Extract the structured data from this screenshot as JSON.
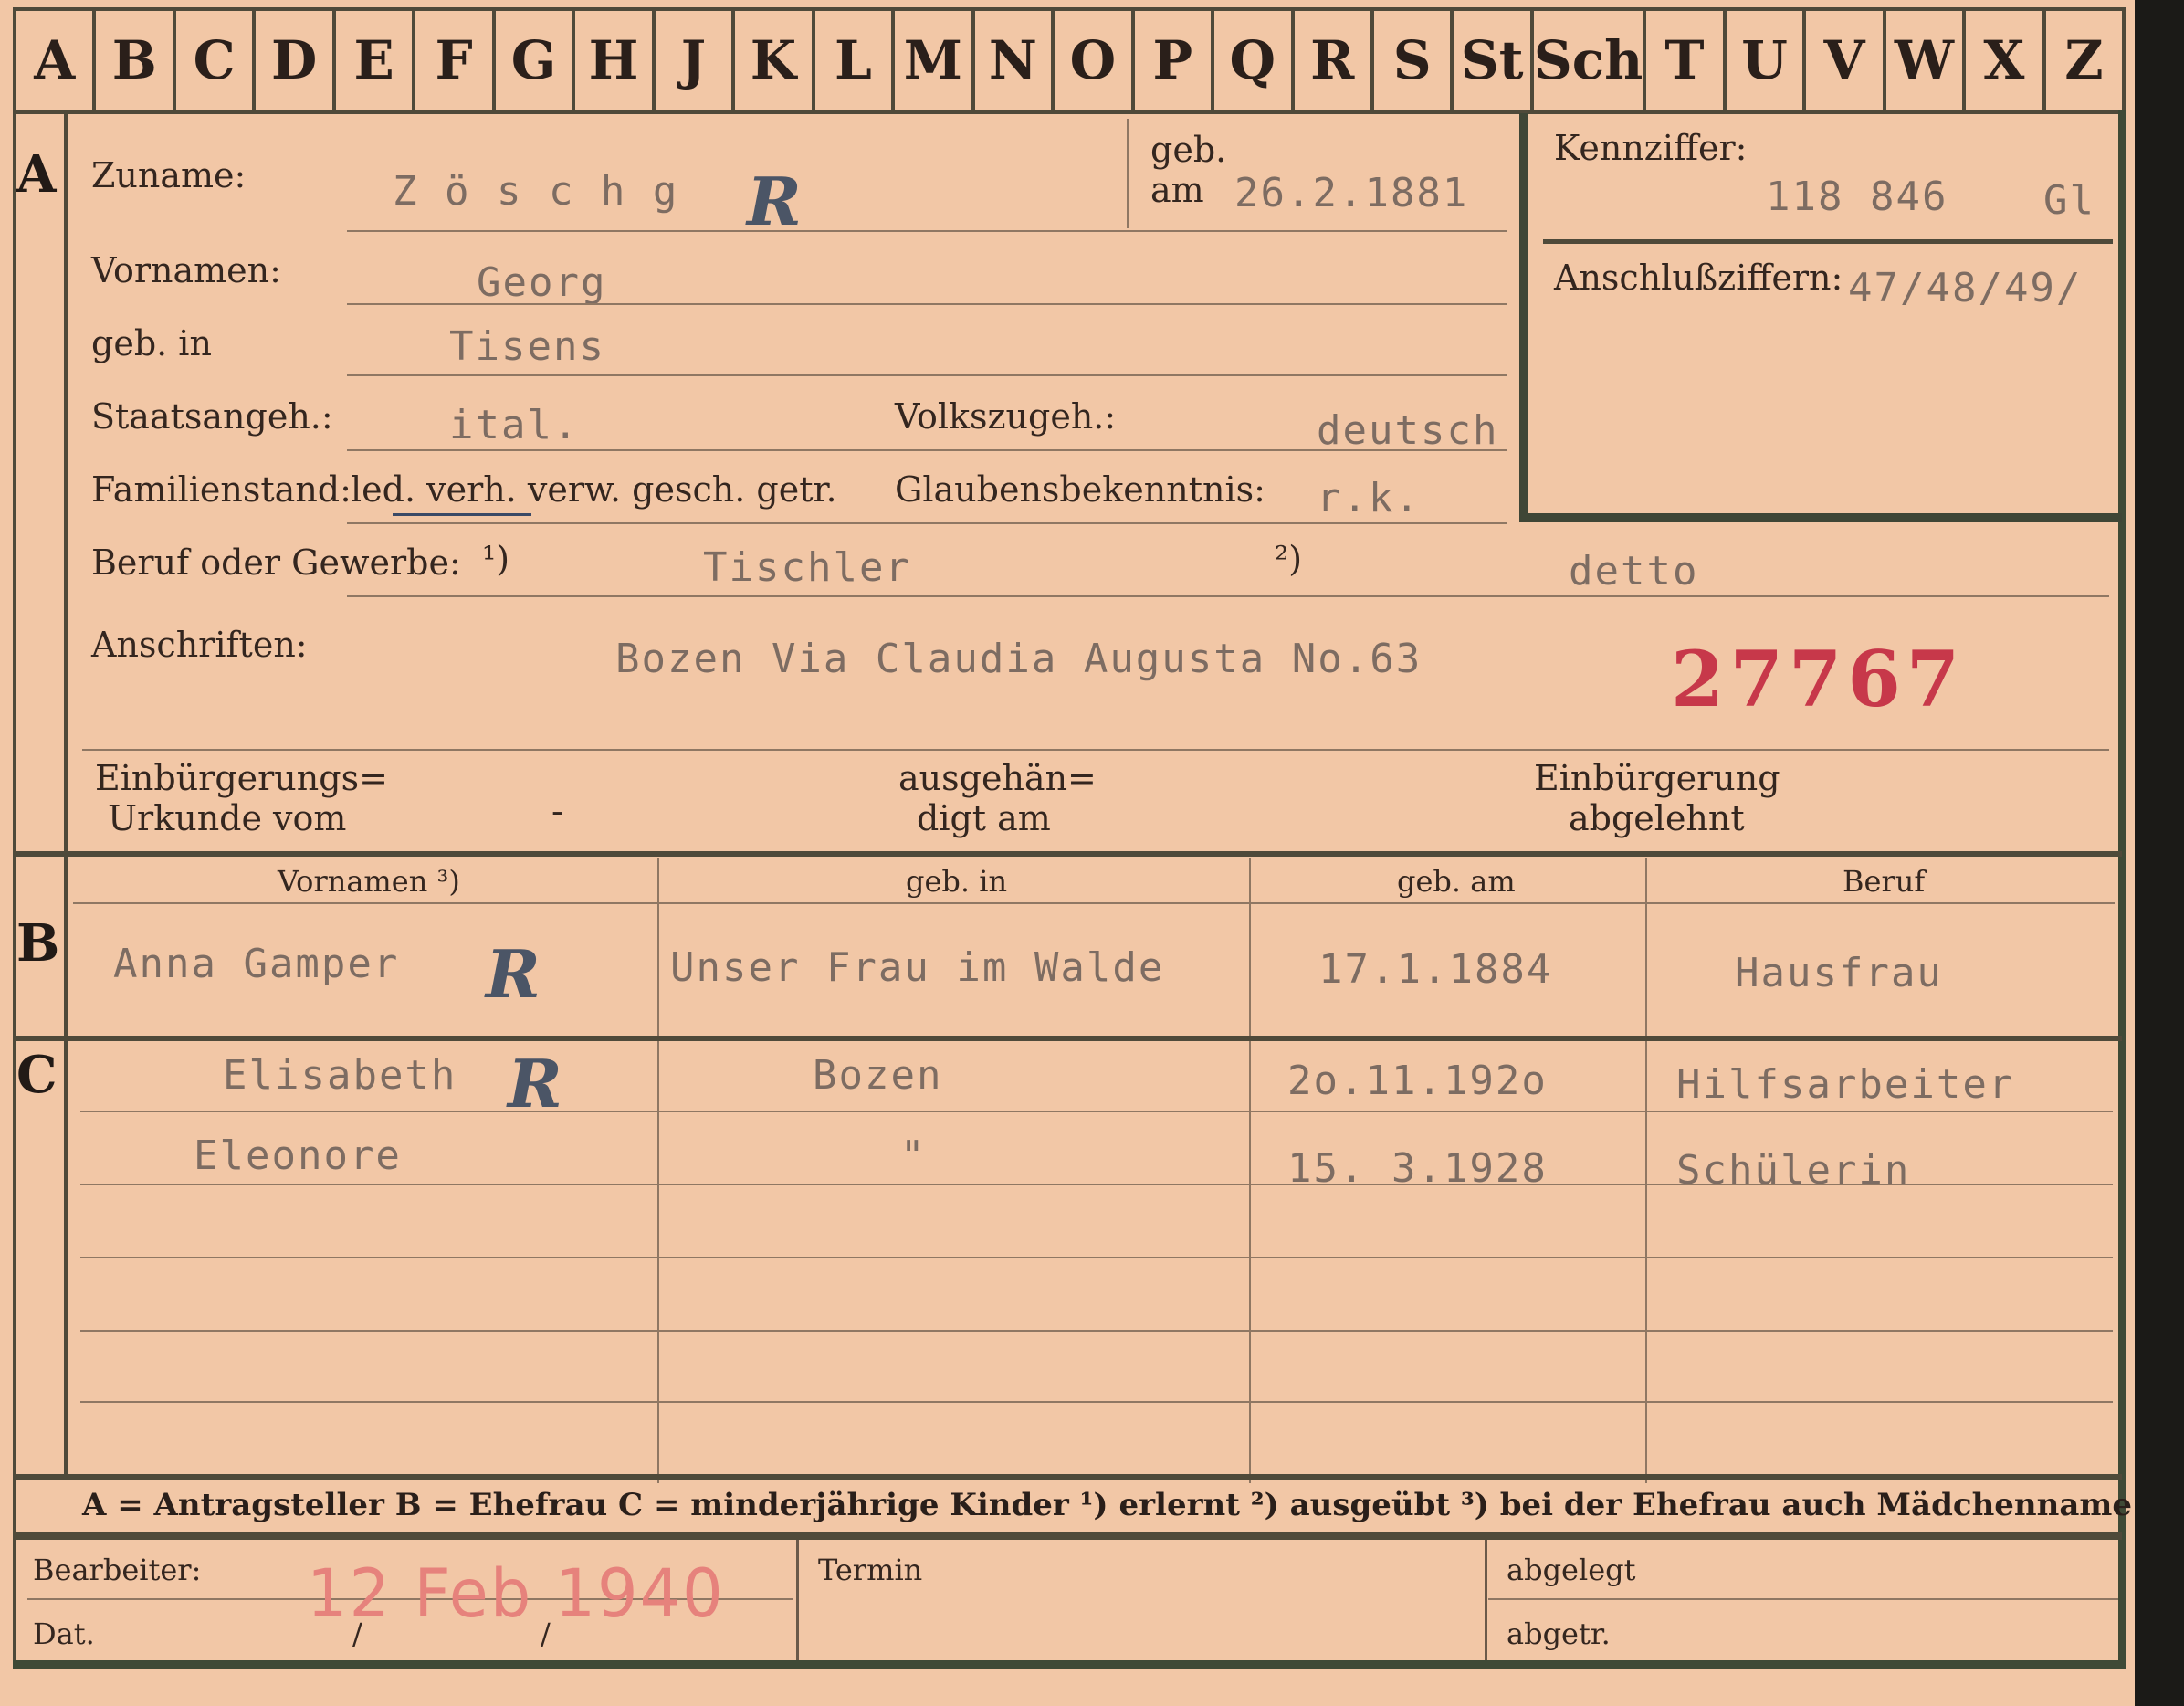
{
  "tabs": [
    "A",
    "B",
    "C",
    "D",
    "E",
    "F",
    "G",
    "H",
    "J",
    "K",
    "L",
    "M",
    "N",
    "O",
    "P",
    "Q",
    "R",
    "S",
    "St",
    "Sch",
    "T",
    "U",
    "V",
    "W",
    "X",
    "Z"
  ],
  "section_a": {
    "marker": "A",
    "surname_label": "Zuname:",
    "surname": "Z ö s c h g",
    "born_label_1": "geb.",
    "born_label_2": "am",
    "born_date": "26.2.1881",
    "first_names_label": "Vornamen:",
    "first_names": "Georg",
    "birthplace_label": "geb. in",
    "birthplace": "Tisens",
    "citizenship_label": "Staatsangeh.:",
    "citizenship": "ital.",
    "ethnicity_label": "Volkszugeh.:",
    "ethnicity": "deutsch",
    "marital_label": "Familienstand:",
    "marital_options": "led. verh. verw. gesch. getr.",
    "religion_label": "Glaubensbekenntnis:",
    "religion": "r.k.",
    "occupation_label": "Beruf oder Gewerbe:",
    "occupation_note_1": "¹)",
    "occupation_1": "Tischler",
    "occupation_note_2": "²)",
    "occupation_2": "detto",
    "address_label": "Anschriften:",
    "address": "Bozen Via Claudia Augusta No.63",
    "red_number": "27767",
    "naturalization_label_1": "Einbürgerungs=",
    "naturalization_label_2": "Urkunde vom",
    "naturalization_dash": "-",
    "handed_label_1": "ausgehän=",
    "handed_label_2": "digt am",
    "rejected_label_1": "Einbürgerung",
    "rejected_label_2": "abgelehnt",
    "code_label": "Kennziffer:",
    "code_value": "118 846",
    "code_suffix": "Gl",
    "connection_label": "Anschlußziffern:",
    "connection_value": "47/48/49/"
  },
  "section_b": {
    "marker": "B",
    "headers": [
      "Vornamen ³)",
      "geb. in",
      "geb. am",
      "Beruf"
    ],
    "row": [
      "Anna Gamper",
      "Unser Frau im Walde",
      "17.1.1884",
      "Hausfrau"
    ]
  },
  "section_c": {
    "marker": "C",
    "rows": [
      [
        "Elisabeth",
        "Bozen",
        "2o.11.192o",
        "Hilfsarbeiter"
      ],
      [
        "Eleonore",
        "\"",
        "15. 3.1928",
        "Schülerin"
      ]
    ]
  },
  "stamp_letter": "R",
  "legend": "A = Antragsteller   B = Ehefrau   C = minderjährige Kinder   ¹) erlernt   ²) ausgeübt   ³) bei der Ehefrau auch Mädchenname",
  "footer": {
    "editor_label": "Bearbeiter:",
    "date_label": "Dat.",
    "date_slash_1": "/",
    "date_slash_2": "/",
    "stamp_date": "12 Feb 1940",
    "deadline_label": "Termin",
    "filed_label": "abgelegt",
    "transferred_label": "abgetr."
  },
  "colors": {
    "paper": "#f2c7a6",
    "ink_lines": "#4f4a3a",
    "typed": "#7d6c62",
    "red_number": "#c7384a",
    "stamp_red": "#e6827c",
    "stamp_blue": "#4b5566"
  }
}
